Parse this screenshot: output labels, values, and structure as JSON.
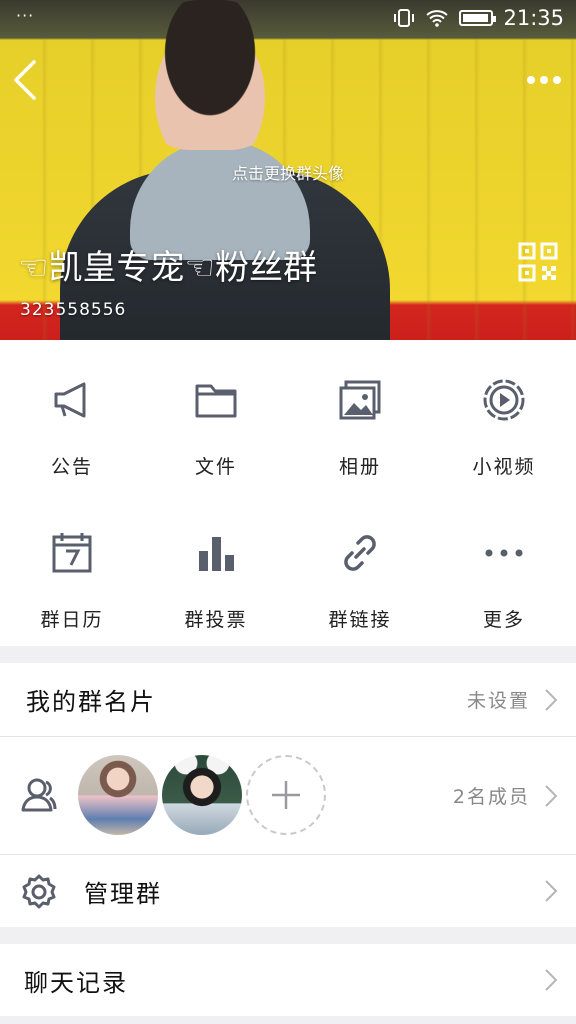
{
  "status_bar": {
    "left_dots": "···",
    "time": "21:35",
    "battery_level": 0.95
  },
  "header": {
    "change_avatar_hint": "点击更换群头像",
    "group_name": "☜凯皇专宠☜粉丝群",
    "group_id": "323558556"
  },
  "features": [
    {
      "label": "公告",
      "icon": "megaphone-icon"
    },
    {
      "label": "文件",
      "icon": "folder-icon"
    },
    {
      "label": "相册",
      "icon": "photo-album-icon"
    },
    {
      "label": "小视频",
      "icon": "video-icon"
    },
    {
      "label": "群日历",
      "icon": "calendar-icon"
    },
    {
      "label": "群投票",
      "icon": "bar-chart-icon"
    },
    {
      "label": "群链接",
      "icon": "link-icon"
    },
    {
      "label": "更多",
      "icon": "more-dots-icon"
    }
  ],
  "rows": {
    "my_card": {
      "title": "我的群名片",
      "value": "未设置"
    },
    "members": {
      "value": "2名成员"
    },
    "manage": {
      "title": "管理群"
    },
    "chat_history": {
      "title": "聊天记录"
    }
  },
  "colors": {
    "icon": "#5a5f6d",
    "accent_red": "#cc1f1c",
    "accent_yellow": "#f1d72e"
  }
}
